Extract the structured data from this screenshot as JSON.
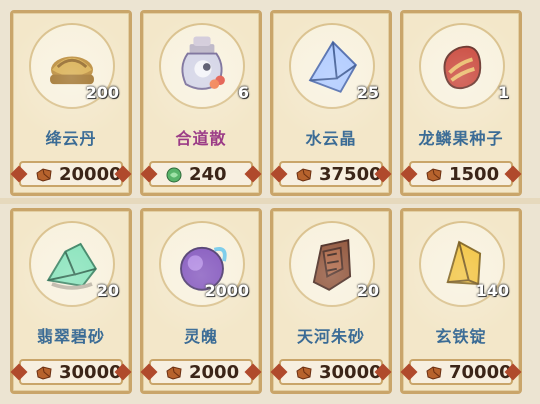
{
  "shop": {
    "items": [
      {
        "name": "绛云丹",
        "qty": "200",
        "price": "20000",
        "price_currency_icon": "ore-chip-icon",
        "item_icon": "golden-pot-icon",
        "name_color": "blue"
      },
      {
        "name": "合道散",
        "qty": "6",
        "price": "240",
        "price_currency_icon": "jade-token-icon",
        "item_icon": "potion-bottle-icon",
        "name_color": "purple"
      },
      {
        "name": "水云晶",
        "qty": "25",
        "price": "37500",
        "price_currency_icon": "ore-chip-icon",
        "item_icon": "blue-crystal-icon",
        "name_color": "blue"
      },
      {
        "name": "龙鳞果种子",
        "qty": "1",
        "price": "1500",
        "price_currency_icon": "ore-chip-icon",
        "item_icon": "red-seed-icon",
        "name_color": "blue"
      },
      {
        "name": "翡翠碧砂",
        "qty": "20",
        "price": "30000",
        "price_currency_icon": "ore-chip-icon",
        "item_icon": "green-crystal-icon",
        "name_color": "blue"
      },
      {
        "name": "灵魄",
        "qty": "2000",
        "price": "2000",
        "price_currency_icon": "ore-chip-icon",
        "item_icon": "purple-orb-icon",
        "name_color": "blue"
      },
      {
        "name": "天河朱砂",
        "qty": "20",
        "price": "30000",
        "price_currency_icon": "ore-chip-icon",
        "item_icon": "red-ore-icon",
        "name_color": "blue"
      },
      {
        "name": "玄铁锭",
        "qty": "140",
        "price": "70000",
        "price_currency_icon": "ore-chip-icon",
        "item_icon": "yellow-crystal-icon",
        "name_color": "blue"
      }
    ]
  },
  "colors": {
    "card_bg": "#f3e7c9",
    "card_border": "#c9a56a",
    "name_blue": "#3a6b95",
    "name_purple": "#9b3b86",
    "price_text": "#3b2518"
  }
}
